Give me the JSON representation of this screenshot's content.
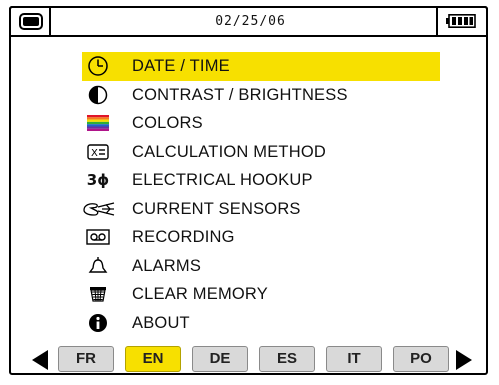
{
  "status_bar": {
    "date": "02/25/06",
    "screen_icon": "display-icon",
    "battery_icon": "battery-full-icon"
  },
  "menu": {
    "selected_index": 0,
    "items": [
      {
        "label": "DATE / TIME",
        "icon": "clock-icon"
      },
      {
        "label": "CONTRAST / BRIGHTNESS",
        "icon": "contrast-icon"
      },
      {
        "label": "COLORS",
        "icon": "color-bars-icon"
      },
      {
        "label": "CALCULATION METHOD",
        "icon": "calculation-icon"
      },
      {
        "label": "ELECTRICAL HOOKUP",
        "icon": "three-phase-icon",
        "icon_text": "3ϕ"
      },
      {
        "label": "CURRENT SENSORS",
        "icon": "current-clamp-icon"
      },
      {
        "label": "RECORDING",
        "icon": "recording-icon"
      },
      {
        "label": "ALARMS",
        "icon": "bell-icon"
      },
      {
        "label": "CLEAR MEMORY",
        "icon": "trash-icon"
      },
      {
        "label": "ABOUT",
        "icon": "info-icon"
      }
    ]
  },
  "languages": {
    "active": "EN",
    "options": [
      "FR",
      "EN",
      "DE",
      "ES",
      "IT",
      "PO"
    ]
  },
  "colors": {
    "highlight": "#f7e000",
    "button_bg": "#d9d9d9"
  }
}
